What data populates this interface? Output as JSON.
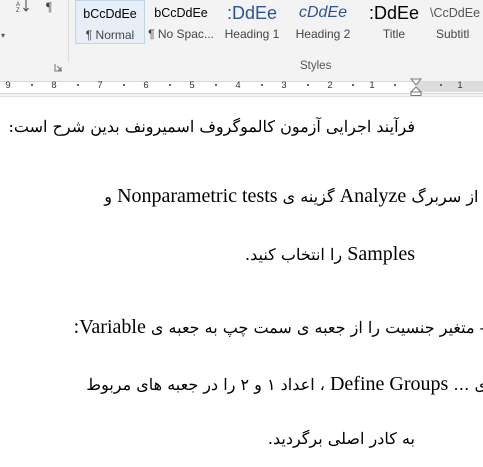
{
  "ribbon": {
    "pilcrow_symbol": "¶",
    "styles": [
      {
        "preview": "bCcDdEe",
        "name": "¶ Normal",
        "selected": true
      },
      {
        "preview": "bCcDdEe",
        "name": "¶ No Spac..."
      },
      {
        "preview": ":DdEe",
        "name": "Heading 1"
      },
      {
        "preview": "cDdEe",
        "name": "Heading 2"
      },
      {
        "preview": ":DdEe",
        "name": "Title"
      },
      {
        "preview": "\\CcDdEe",
        "name": "Subtitl"
      }
    ],
    "group_label": "Styles"
  },
  "ruler": {
    "numbers": [
      "9",
      "8",
      "7",
      "6",
      "5",
      "4",
      "3",
      "2",
      "1",
      "1"
    ]
  },
  "document": {
    "line1": "فرآیند اجرایی آزمون کالموگروف اسمیرونف بدین شرح است:",
    "line2_pre": "- از سربرگ",
    "line2_latin1": "Analyze",
    "line2_mid": "گزینه ی",
    "line2_latin2": "Nonparametric tests",
    "line2_end": "و",
    "line3_latin": "Samples",
    "line3_text": "را انتخاب کنید.",
    "line4_text": "- متغیر جنسیت را از جعبه ی سمت چپ به جعبه ی",
    "line4_latin": ":Variable",
    "line5_pre": "ی …",
    "line5_latin": "Define Groups",
    "line5_text": "، اعداد ۱ و ۲ را در جعبه های مربوط",
    "line6_text": "به کادر اصلی برگردید."
  }
}
